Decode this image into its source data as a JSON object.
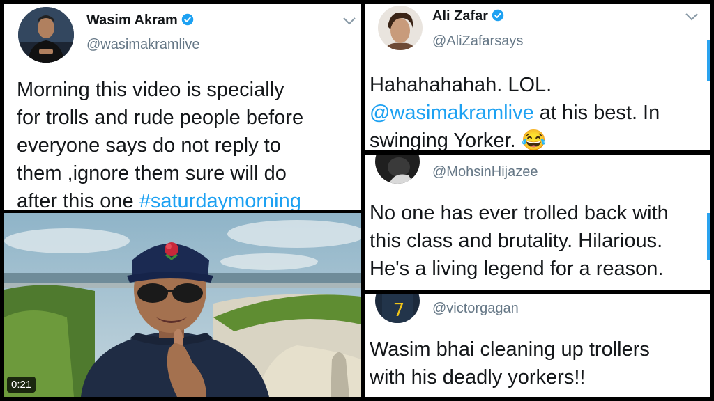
{
  "tweet_main": {
    "name": "Wasim Akram",
    "handle": "@wasimakramlive",
    "text": "Morning this video is specially\nfor trolls and rude people before\neveryone says do not reply to\nthem ,ignore them sure will do\nafter this one ",
    "hashtag": "#saturdaymorning"
  },
  "video": {
    "duration": "0:21"
  },
  "reply_ali": {
    "name": "Ali Zafar",
    "handle": "@AliZafarsays",
    "text_1": "Hahahahahah. LOL.",
    "mention": "@wasimakramlive",
    "text_2": " at his best. In\nswinging Yorker. ",
    "emoji": "😂"
  },
  "reply_mohsin": {
    "handle": "@MohsinHijazee",
    "text": "No one has ever trolled back with\nthis class and brutality. Hilarious.\nHe's a living legend for a reason."
  },
  "reply_victor": {
    "handle": "@victorgagan",
    "text": "Wasim bhai cleaning up trollers\nwith his deadly yorkers!!"
  },
  "colors": {
    "link": "#1da1f2",
    "verified": "#1da1f2",
    "handle": "#657786"
  }
}
